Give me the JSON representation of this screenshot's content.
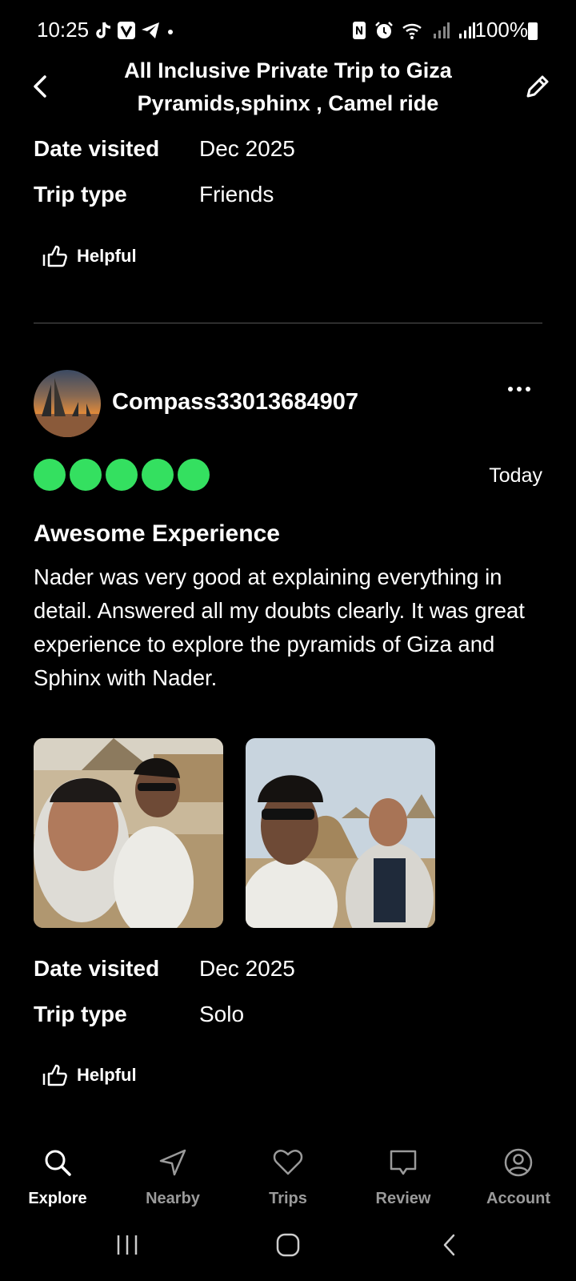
{
  "status_bar": {
    "time": "10:25",
    "battery_text": "100%",
    "left_icons": [
      "tiktok-icon",
      "v-app-icon",
      "telegram-icon",
      "dot-icon"
    ],
    "right_icons": [
      "nfc-icon",
      "alarm-icon",
      "wifi-icon",
      "signal-icon",
      "signal-icon",
      "battery-icon"
    ]
  },
  "header": {
    "title": "All Inclusive Private Trip to Giza Pyramids,sphinx , Camel ride"
  },
  "previous_review": {
    "date_visited_label": "Date visited",
    "date_visited_value": "Dec 2025",
    "trip_type_label": "Trip type",
    "trip_type_value": "Friends",
    "helpful_label": "Helpful"
  },
  "review": {
    "username": "Compass33013684907",
    "rating": 5,
    "rating_max": 5,
    "date": "Today",
    "title": "Awesome Experience",
    "body": "Nader was very good at explaining everything in detail. Answered all my doubts clearly. It was great experience to explore the pyramids of Giza and Sphinx with Nader.",
    "date_visited_label": "Date visited",
    "date_visited_value": "Dec 2025",
    "trip_type_label": "Trip type",
    "trip_type_value": "Solo",
    "helpful_label": "Helpful"
  },
  "bottom_nav": {
    "items": [
      {
        "label": "Explore",
        "icon": "search-icon",
        "active": true
      },
      {
        "label": "Nearby",
        "icon": "navigation-arrow-icon",
        "active": false
      },
      {
        "label": "Trips",
        "icon": "heart-icon",
        "active": false
      },
      {
        "label": "Review",
        "icon": "speech-bubble-icon",
        "active": false
      },
      {
        "label": "Account",
        "icon": "user-circle-icon",
        "active": false
      }
    ]
  },
  "colors": {
    "background": "#000000",
    "rating_green": "#34e060",
    "inactive_nav": "#9a9a9a"
  }
}
